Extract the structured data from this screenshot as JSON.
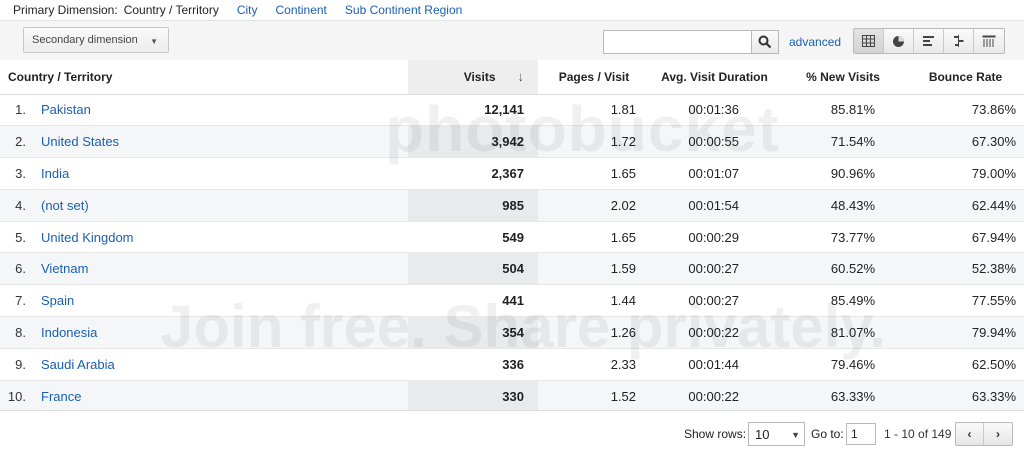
{
  "primary_dimension": {
    "label": "Primary Dimension:",
    "current": "Country / Territory",
    "options": [
      "City",
      "Continent",
      "Sub Continent Region"
    ]
  },
  "toolbar": {
    "secondary_dimension": "Secondary dimension",
    "search_placeholder": "",
    "advanced_label": "advanced",
    "view_icons": [
      "table-view-icon",
      "pie-view-icon",
      "bar-view-icon",
      "comparison-view-icon",
      "pivot-view-icon"
    ]
  },
  "table": {
    "headers": {
      "country": "Country / Territory",
      "visits": "Visits",
      "pages_per_visit": "Pages / Visit",
      "avg_duration": "Avg. Visit Duration",
      "new_visits": "% New Visits",
      "bounce_rate": "Bounce Rate"
    },
    "sort_icon": "sort-down-arrow-icon",
    "rows": [
      {
        "idx": "1.",
        "country": "Pakistan",
        "visits": "12,141",
        "ppv": "1.81",
        "dur": "00:01:36",
        "nv": "85.81%",
        "br": "73.86%"
      },
      {
        "idx": "2.",
        "country": "United States",
        "visits": "3,942",
        "ppv": "1.72",
        "dur": "00:00:55",
        "nv": "71.54%",
        "br": "67.30%"
      },
      {
        "idx": "3.",
        "country": "India",
        "visits": "2,367",
        "ppv": "1.65",
        "dur": "00:01:07",
        "nv": "90.96%",
        "br": "79.00%"
      },
      {
        "idx": "4.",
        "country": "(not set)",
        "visits": "985",
        "ppv": "2.02",
        "dur": "00:01:54",
        "nv": "48.43%",
        "br": "62.44%"
      },
      {
        "idx": "5.",
        "country": "United Kingdom",
        "visits": "549",
        "ppv": "1.65",
        "dur": "00:00:29",
        "nv": "73.77%",
        "br": "67.94%"
      },
      {
        "idx": "6.",
        "country": "Vietnam",
        "visits": "504",
        "ppv": "1.59",
        "dur": "00:00:27",
        "nv": "60.52%",
        "br": "52.38%"
      },
      {
        "idx": "7.",
        "country": "Spain",
        "visits": "441",
        "ppv": "1.44",
        "dur": "00:00:27",
        "nv": "85.49%",
        "br": "77.55%"
      },
      {
        "idx": "8.",
        "country": "Indonesia",
        "visits": "354",
        "ppv": "1.26",
        "dur": "00:00:22",
        "nv": "81.07%",
        "br": "79.94%"
      },
      {
        "idx": "9.",
        "country": "Saudi Arabia",
        "visits": "336",
        "ppv": "2.33",
        "dur": "00:01:44",
        "nv": "79.46%",
        "br": "62.50%"
      },
      {
        "idx": "10.",
        "country": "France",
        "visits": "330",
        "ppv": "1.52",
        "dur": "00:00:22",
        "nv": "63.33%",
        "br": "63.33%"
      }
    ]
  },
  "footer": {
    "show_rows_label": "Show rows:",
    "rows_value": "10",
    "goto_label": "Go to:",
    "goto_value": "1",
    "range_text": "1 - 10 of 149",
    "prev_label": "‹",
    "next_label": "›"
  },
  "watermark": {
    "top": "photobucket",
    "bottom": "Join free. Share privately."
  },
  "colors": {
    "link": "#1a5fb4",
    "sorted_column": "#eeeeee",
    "row_stripe": "#f5f6f8"
  }
}
